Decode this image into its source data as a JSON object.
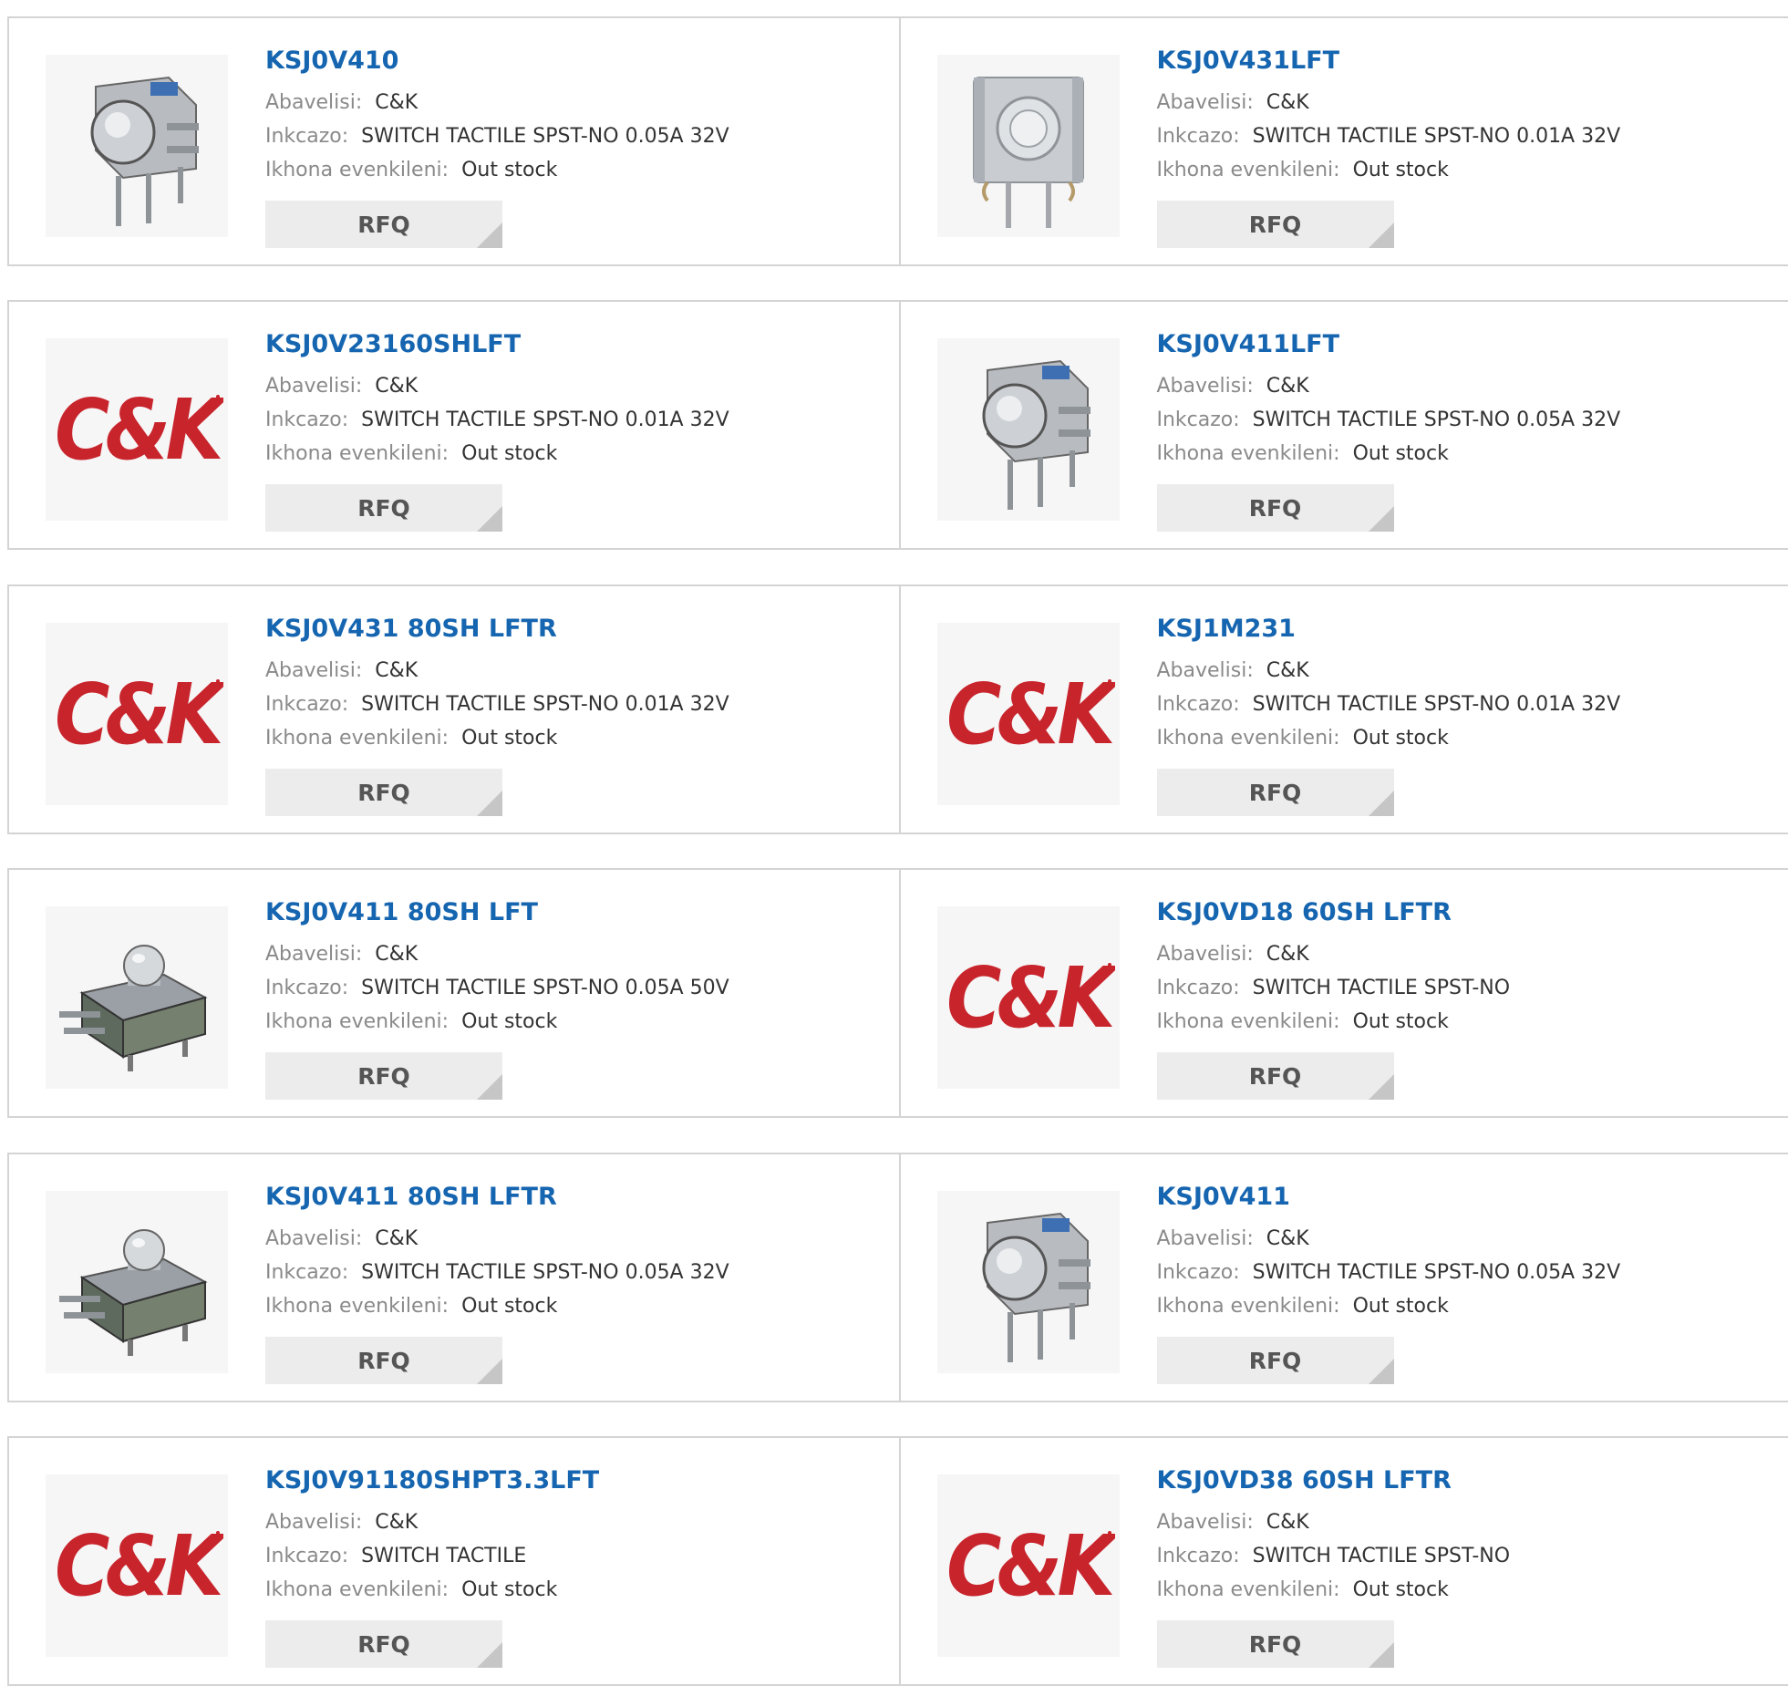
{
  "labels": {
    "manufacturer": "Abavelisi:",
    "description": "Inkcazo:",
    "stock": "Ikhona evenkileni:",
    "rfq": "RFQ"
  },
  "colors": {
    "part_link": "#1565b0",
    "logo_red": "#c8242c",
    "border": "#d4d4d4",
    "button_bg": "#ececec"
  },
  "products": [
    {
      "part": "KSJ0V410",
      "manufacturer": "C&K",
      "description": "SWITCH TACTILE SPST-NO 0.05A 32V",
      "stock": "Out stock",
      "image": "side-switch-photo"
    },
    {
      "part": "KSJ0V431LFT",
      "manufacturer": "C&K",
      "description": "SWITCH TACTILE SPST-NO 0.01A 32V",
      "stock": "Out stock",
      "image": "front-switch-photo"
    },
    {
      "part": "KSJ0V23160SHLFT",
      "manufacturer": "C&K",
      "description": "SWITCH TACTILE SPST-NO 0.01A 32V",
      "stock": "Out stock",
      "image": "ck-logo"
    },
    {
      "part": "KSJ0V411LFT",
      "manufacturer": "C&K",
      "description": "SWITCH TACTILE SPST-NO 0.05A 32V",
      "stock": "Out stock",
      "image": "side-switch-photo"
    },
    {
      "part": "KSJ0V431 80SH LFTR",
      "manufacturer": "C&K",
      "description": "SWITCH TACTILE SPST-NO 0.01A 32V",
      "stock": "Out stock",
      "image": "ck-logo"
    },
    {
      "part": "KSJ1M231",
      "manufacturer": "C&K",
      "description": "SWITCH TACTILE SPST-NO 0.01A 32V",
      "stock": "Out stock",
      "image": "ck-logo"
    },
    {
      "part": "KSJ0V411 80SH LFT",
      "manufacturer": "C&K",
      "description": "SWITCH TACTILE SPST-NO 0.05A 50V",
      "stock": "Out stock",
      "image": "angled-switch-photo"
    },
    {
      "part": "KSJ0VD18 60SH LFTR",
      "manufacturer": "C&K",
      "description": "SWITCH TACTILE SPST-NO",
      "stock": "Out stock",
      "image": "ck-logo"
    },
    {
      "part": "KSJ0V411 80SH LFTR",
      "manufacturer": "C&K",
      "description": "SWITCH TACTILE SPST-NO 0.05A 32V",
      "stock": "Out stock",
      "image": "angled-switch-photo"
    },
    {
      "part": "KSJ0V411",
      "manufacturer": "C&K",
      "description": "SWITCH TACTILE SPST-NO 0.05A 32V",
      "stock": "Out stock",
      "image": "side-switch-photo"
    },
    {
      "part": "KSJ0V91180SHPT3.3LFT",
      "manufacturer": "C&K",
      "description": "SWITCH TACTILE",
      "stock": "Out stock",
      "image": "ck-logo"
    },
    {
      "part": "KSJ0VD38 60SH LFTR",
      "manufacturer": "C&K",
      "description": "SWITCH TACTILE SPST-NO",
      "stock": "Out stock",
      "image": "ck-logo"
    }
  ],
  "logo_text": "C&K"
}
